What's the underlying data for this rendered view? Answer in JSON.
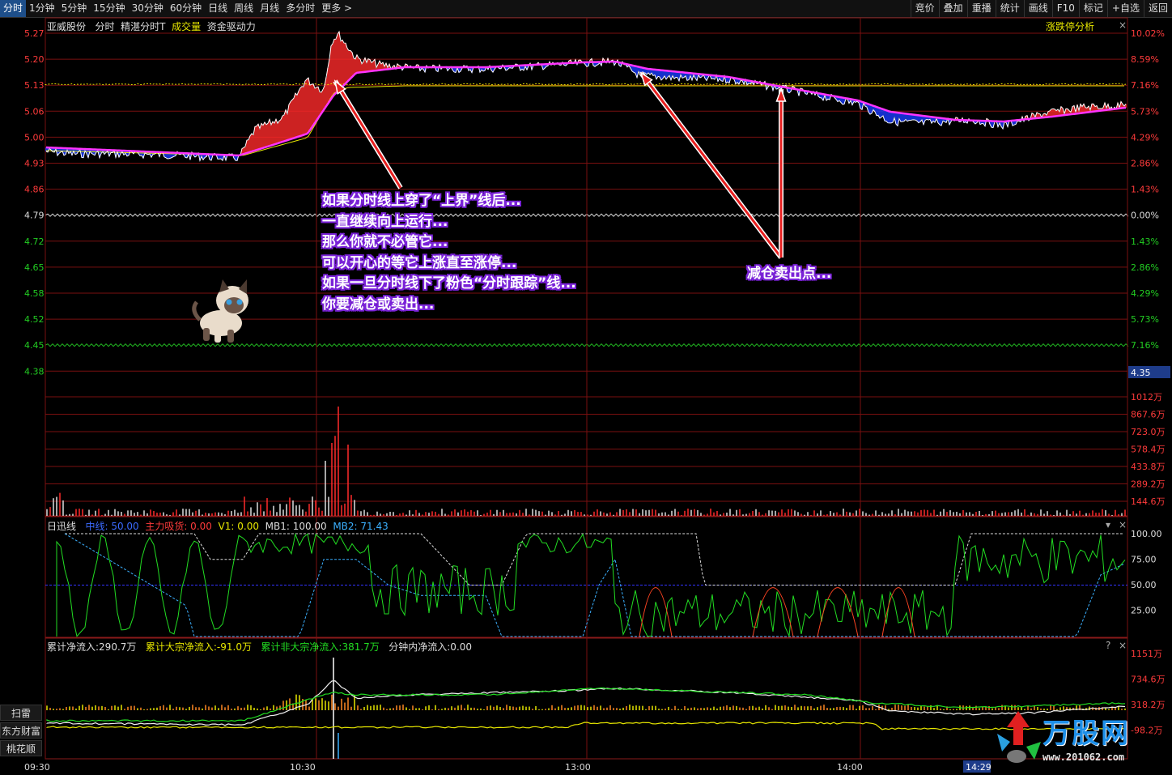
{
  "toolbar": {
    "periods": [
      "分时",
      "1分钟",
      "5分钟",
      "15分钟",
      "30分钟",
      "60分钟",
      "日线",
      "周线",
      "月线",
      "多分时",
      "更多 >"
    ],
    "actions": [
      "竞价",
      "叠加",
      "重播",
      "统计",
      "画线",
      "F10",
      "标记",
      "+自选",
      "返回"
    ]
  },
  "header": {
    "stock_name": "亚威股份",
    "mode": "分时",
    "indicator1": "精湛分时T",
    "volume_label": "成交量",
    "capital_label": "资金驱动力",
    "limit_analysis": "涨跌停分析"
  },
  "price_panel": {
    "left_ticks": [
      "5.27",
      "5.20",
      "5.13",
      "5.06",
      "5.00",
      "4.93",
      "4.86",
      "4.79",
      "4.72",
      "4.65",
      "4.58",
      "4.52",
      "4.45",
      "4.38"
    ],
    "right_ticks": [
      "10.02%",
      "8.59%",
      "7.16%",
      "5.73%",
      "4.29%",
      "2.86%",
      "1.43%",
      "0.00%",
      "1.43%",
      "2.86%",
      "4.29%",
      "5.73%",
      "7.16%"
    ],
    "price_marker": "4.35"
  },
  "volume_panel": {
    "ticks": [
      "1012万",
      "867.6万",
      "723.0万",
      "578.4万",
      "433.8万",
      "289.2万",
      "144.6万"
    ]
  },
  "indicator_panel": {
    "name": "日迅线",
    "zhongxian_label": "中线: 50.00",
    "zhuli_label": "主力吸货: 0.00",
    "v1_label": "V1: 0.00",
    "mb1_label": "MB1: 100.00",
    "mb2_label": "MB2: 71.43",
    "ticks": [
      "100.00",
      "75.00",
      "50.00",
      "25.00"
    ]
  },
  "flow_panel": {
    "cum_flow": "累计净流入:290.7万",
    "cum_block": "累计大宗净流入:-91.0万",
    "cum_nonblock": "累计非大宗净流入:381.7万",
    "min_flow": "分钟内净流入:0.00",
    "ticks": [
      "1151万",
      "734.6万",
      "318.2万",
      "-98.2万"
    ],
    "help": "?",
    "close": "×"
  },
  "sidebar": [
    "扫雷",
    "东方财富",
    "桃花顺"
  ],
  "time_axis": {
    "labels": [
      "09:30",
      "10:30",
      "13:00",
      "14:00"
    ],
    "cursor": "14:29"
  },
  "annotation_left": [
    "如果分时线上穿了“上界”线后...",
    "一直继续向上运行...",
    "那么你就不必管它...",
    "可以开心的等它上涨直至涨停...",
    "如果一旦分时线下了粉色“分时跟踪”线...",
    "你要减仓或卖出..."
  ],
  "annotation_right": "减仓卖出点...",
  "watermark": {
    "name": "万股网",
    "url": "www.201062.com"
  },
  "colors": {
    "up": "#ff2a2a",
    "down": "#1a3cff",
    "pink": "#ff33ff",
    "yellow": "#e6e600",
    "green": "#22dd22",
    "grid": "#7a1010"
  }
}
